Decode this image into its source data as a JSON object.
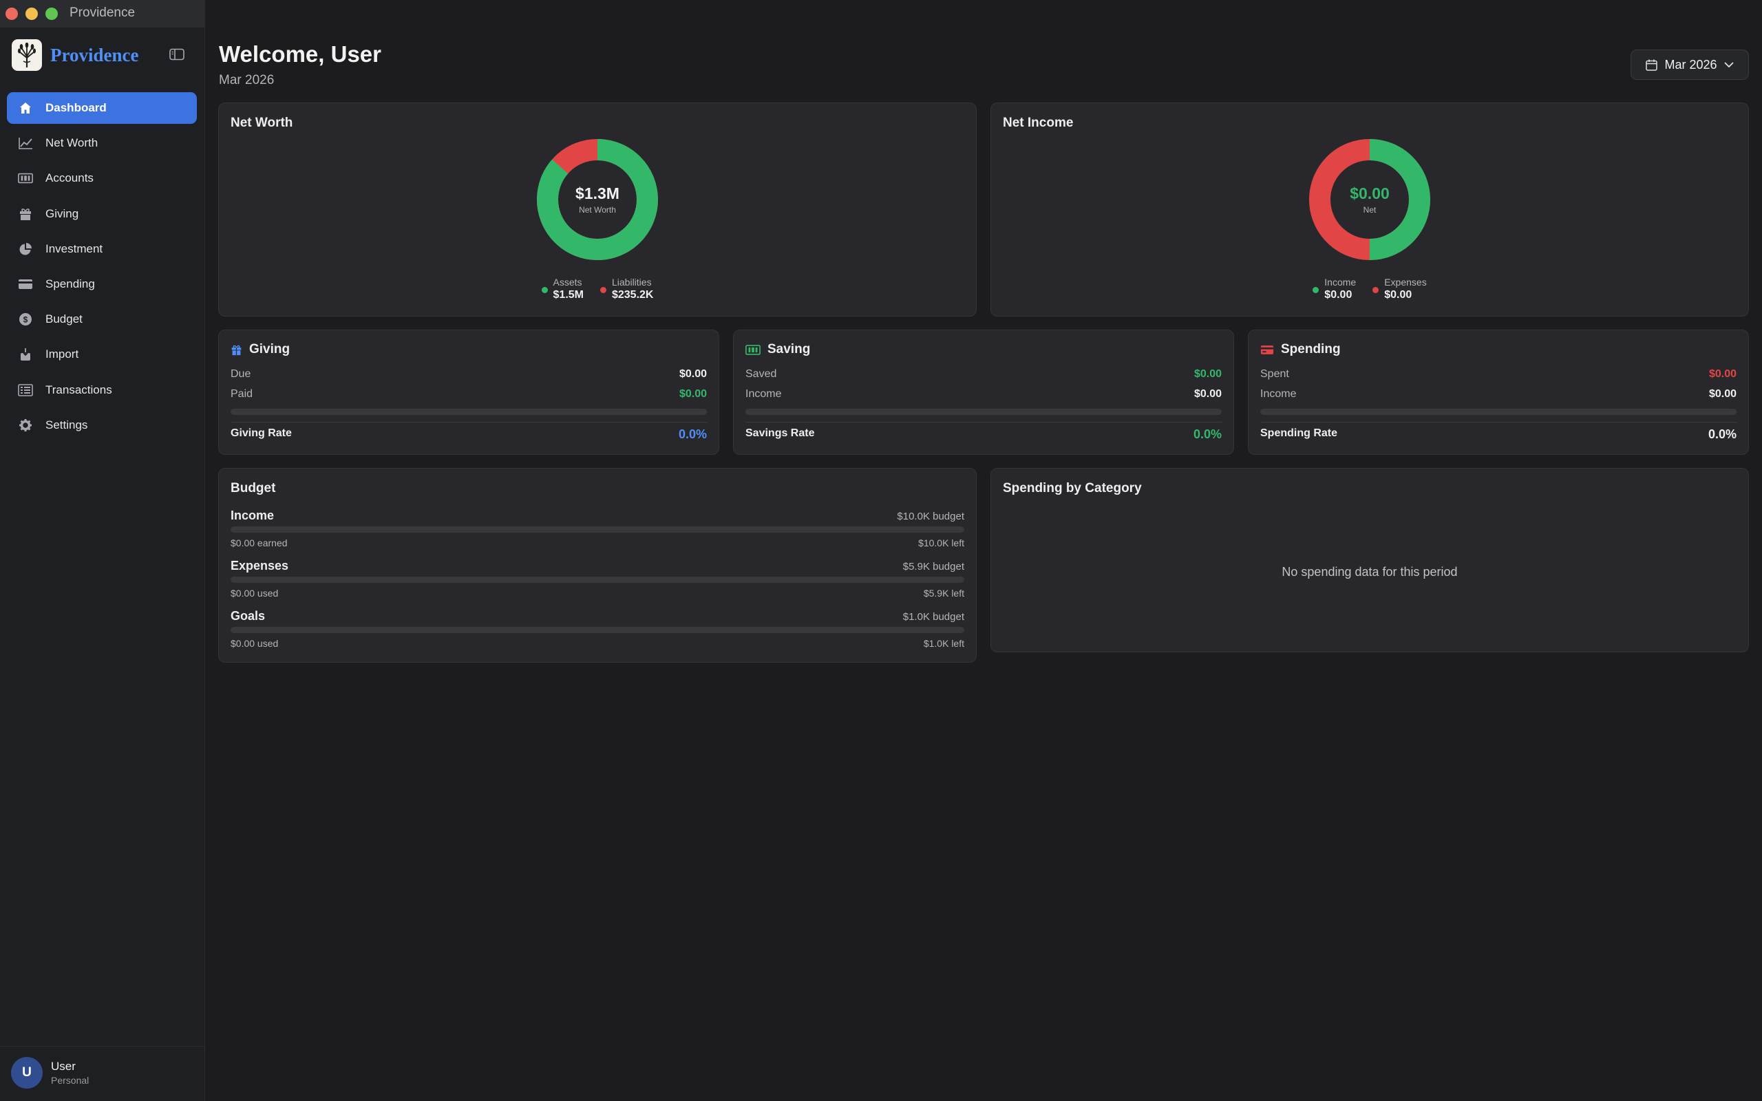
{
  "window": {
    "title": "Providence"
  },
  "brand": {
    "name": "Providence"
  },
  "sidebar": {
    "items": [
      {
        "label": "Dashboard",
        "icon": "house-icon",
        "active": true
      },
      {
        "label": "Net Worth",
        "icon": "trend-line-icon"
      },
      {
        "label": "Accounts",
        "icon": "banknote-icon"
      },
      {
        "label": "Giving",
        "icon": "gift-icon"
      },
      {
        "label": "Investment",
        "icon": "pie-chart-icon"
      },
      {
        "label": "Spending",
        "icon": "credit-card-icon"
      },
      {
        "label": "Budget",
        "icon": "dollar-circle-icon"
      },
      {
        "label": "Import",
        "icon": "import-tray-icon"
      },
      {
        "label": "Transactions",
        "icon": "list-icon"
      },
      {
        "label": "Settings",
        "icon": "gear-icon"
      }
    ],
    "user": {
      "initial": "U",
      "name": "User",
      "subtitle": "Personal"
    }
  },
  "header": {
    "welcome": "Welcome, User",
    "period": "Mar 2026",
    "date_picker": "Mar 2026"
  },
  "net_worth": {
    "title": "Net Worth",
    "center_value": "$1.3M",
    "center_label": "Net Worth",
    "assets_label": "Assets",
    "assets_value": "$1.5M",
    "liabilities_label": "Liabilities",
    "liabilities_value": "$235.2K",
    "assets_fraction": 0.865
  },
  "net_income": {
    "title": "Net Income",
    "center_value": "$0.00",
    "center_label": "Net",
    "income_label": "Income",
    "income_value": "$0.00",
    "expenses_label": "Expenses",
    "expenses_value": "$0.00",
    "income_fraction": 0.5
  },
  "giving": {
    "title": "Giving",
    "row1_label": "Due",
    "row1_value": "$0.00",
    "row2_label": "Paid",
    "row2_value": "$0.00",
    "progress": 0,
    "rate_label": "Giving Rate",
    "rate_value": "0.0%"
  },
  "saving": {
    "title": "Saving",
    "row1_label": "Saved",
    "row1_value": "$0.00",
    "row2_label": "Income",
    "row2_value": "$0.00",
    "progress": 0,
    "rate_label": "Savings Rate",
    "rate_value": "0.0%"
  },
  "spending": {
    "title": "Spending",
    "row1_label": "Spent",
    "row1_value": "$0.00",
    "row2_label": "Income",
    "row2_value": "$0.00",
    "progress": 0,
    "rate_label": "Spending Rate",
    "rate_value": "0.0%"
  },
  "budget": {
    "title": "Budget",
    "rows": [
      {
        "name": "Income",
        "budget": "$10.0K budget",
        "used": "$0.00 earned",
        "left": "$10.0K left",
        "progress": 0
      },
      {
        "name": "Expenses",
        "budget": "$5.9K budget",
        "used": "$0.00 used",
        "left": "$5.9K left",
        "progress": 0
      },
      {
        "name": "Goals",
        "budget": "$1.0K budget",
        "used": "$0.00 used",
        "left": "$1.0K left",
        "progress": 0
      }
    ]
  },
  "spending_by_category": {
    "title": "Spending by Category",
    "empty_message": "No spending data for this period"
  },
  "colors": {
    "accent": "#3d73e0",
    "brand": "#4f8ff7",
    "positive": "#33b86a",
    "negative": "#e24545"
  }
}
